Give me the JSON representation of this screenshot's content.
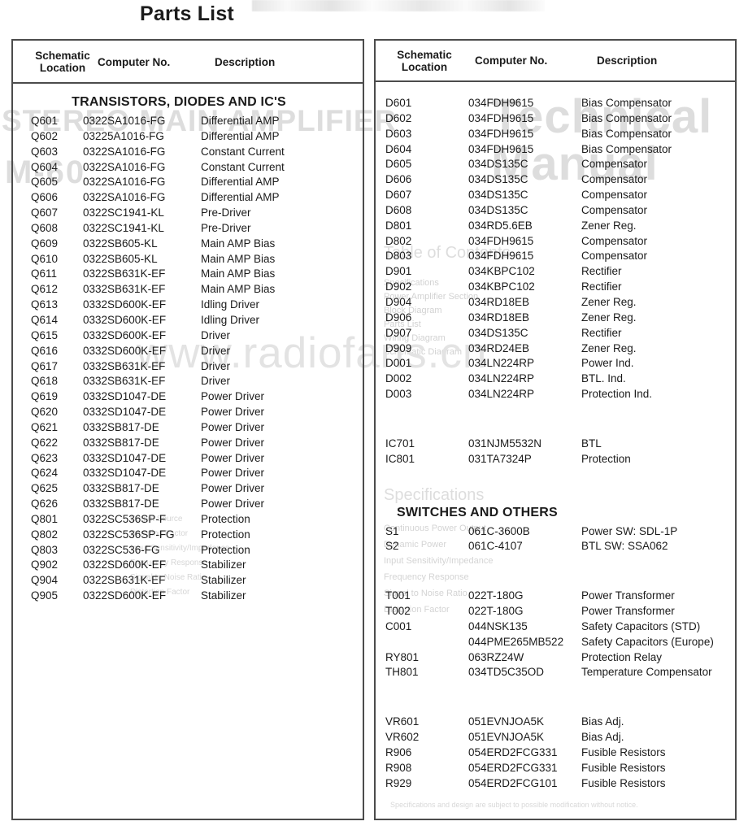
{
  "page": {
    "title": "Parts List",
    "watermark": "www.radiofans.cn"
  },
  "ghost_text": {
    "stereo": "STEREO MAIN AMPLIFIER",
    "model": "M-60",
    "brand_line1": "Technical",
    "brand_line2": "Manual",
    "toc": "Table of Contents",
    "spec": "Specifications",
    "toc_lines": "Specifications\nPower Amplifier Section\nBlock Diagram\nParts List\nWiring Diagram\nSchematic Diagram",
    "spec_lines": "Continuous Power Output\nDynamic Power\nInput Sensitivity/Impedance\nFrequency Response\nSignal to Noise Ratio\nDistortion Factor",
    "mid_lines": "Output Source\nDamping Factor\nInput Sensitivity/Impedance\nFrequency Response\nSignal to Noise Ratio\nDistortion Factor",
    "bottom_note": "Specifications and design are subject to possible modification without notice."
  },
  "tables": {
    "left": {
      "headers": {
        "location": "Schematic\nLocation",
        "location_line1": "Schematic",
        "location_line2": "Location",
        "number": "Computer No.",
        "description": "Description"
      },
      "sections": [
        {
          "title": "TRANSISTORS, DIODES AND IC'S",
          "rows": [
            {
              "loc": "Q601",
              "num": "0322SA1016-FG",
              "desc": "Differential AMP"
            },
            {
              "loc": "Q602",
              "num": "03225A1016-FG",
              "desc": "Differential AMP"
            },
            {
              "loc": "Q603",
              "num": "0322SA1016-FG",
              "desc": "Constant Current"
            },
            {
              "loc": "Q604",
              "num": "0322SA1016-FG",
              "desc": "Constant Current"
            },
            {
              "loc": "Q605",
              "num": "0322SA1016-FG",
              "desc": "Differential AMP"
            },
            {
              "loc": "Q606",
              "num": "0322SA1016-FG",
              "desc": "Differential AMP"
            },
            {
              "loc": "Q607",
              "num": "0322SC1941-KL",
              "desc": "Pre-Driver"
            },
            {
              "loc": "Q608",
              "num": "0322SC1941-KL",
              "desc": "Pre-Driver"
            },
            {
              "loc": "Q609",
              "num": "0322SB605-KL",
              "desc": "Main AMP Bias"
            },
            {
              "loc": "Q610",
              "num": "0322SB605-KL",
              "desc": "Main AMP Bias"
            },
            {
              "loc": "Q611",
              "num": "0322SB631K-EF",
              "desc": "Main AMP Bias"
            },
            {
              "loc": "Q612",
              "num": "0332SB631K-EF",
              "desc": "Main AMP Bias"
            },
            {
              "loc": "Q613",
              "num": "0332SD600K-EF",
              "desc": "Idling Driver"
            },
            {
              "loc": "Q614",
              "num": "0332SD600K-EF",
              "desc": "Idling Driver"
            },
            {
              "loc": "Q615",
              "num": "0332SD600K-EF",
              "desc": "Driver"
            },
            {
              "loc": "Q616",
              "num": "0332SD600K-EF",
              "desc": "Driver"
            },
            {
              "loc": "Q617",
              "num": "0332SB631K-EF",
              "desc": "Driver"
            },
            {
              "loc": "Q618",
              "num": "0332SB631K-EF",
              "desc": "Driver"
            },
            {
              "loc": "Q619",
              "num": "0332SD1047-DE",
              "desc": "Power Driver"
            },
            {
              "loc": "Q620",
              "num": "0332SD1047-DE",
              "desc": "Power Driver"
            },
            {
              "loc": "Q621",
              "num": "0332SB817-DE",
              "desc": "Power Driver"
            },
            {
              "loc": "Q622",
              "num": "0332SB817-DE",
              "desc": "Power Driver"
            },
            {
              "loc": "Q623",
              "num": "0332SD1047-DE",
              "desc": "Power Driver"
            },
            {
              "loc": "Q624",
              "num": "0332SD1047-DE",
              "desc": "Power Driver"
            },
            {
              "loc": "Q625",
              "num": "0332SB817-DE",
              "desc": "Power Driver"
            },
            {
              "loc": "Q626",
              "num": "0332SB817-DE",
              "desc": "Power Driver"
            },
            {
              "loc": "Q801",
              "num": "0322SC536SP-F",
              "desc": "Protection"
            },
            {
              "loc": "Q802",
              "num": "0322SC536SP-FG",
              "desc": "Protection"
            },
            {
              "loc": "Q803",
              "num": "0322SC536-FG",
              "desc": "Protection"
            },
            {
              "loc": "Q902",
              "num": "0322SD600K-EF",
              "desc": "Stabilizer"
            },
            {
              "loc": "Q904",
              "num": "0322SB631K-EF",
              "desc": "Stabilizer"
            },
            {
              "loc": "Q905",
              "num": "0322SD600K-EF",
              "desc": "Stabilizer"
            }
          ]
        }
      ]
    },
    "right": {
      "headers": {
        "location_line1": "Schematic",
        "location_line2": "Location",
        "number": "Computer No.",
        "description": "Description"
      },
      "groups": [
        {
          "title": "",
          "rows": [
            {
              "loc": "D601",
              "num": "034FDH9615",
              "desc": "Bias Compensator"
            },
            {
              "loc": "D602",
              "num": "034FDH9615",
              "desc": "Bias Compensator"
            },
            {
              "loc": "D603",
              "num": "034FDH9615",
              "desc": "Bias Compensator"
            },
            {
              "loc": "D604",
              "num": "034FDH9615",
              "desc": "Bias Compensator"
            },
            {
              "loc": "D605",
              "num": "034DS135C",
              "desc": "Compensator"
            },
            {
              "loc": "D606",
              "num": "034DS135C",
              "desc": "Compensator"
            },
            {
              "loc": "D607",
              "num": "034DS135C",
              "desc": "Compensator"
            },
            {
              "loc": "D608",
              "num": "034DS135C",
              "desc": "Compensator"
            },
            {
              "loc": "D801",
              "num": "034RD5.6EB",
              "desc": "Zener Reg."
            },
            {
              "loc": "D802",
              "num": "034FDH9615",
              "desc": "Compensator"
            },
            {
              "loc": "D803",
              "num": "034FDH9615",
              "desc": "Compensator"
            },
            {
              "loc": "D901",
              "num": "034KBPC102",
              "desc": "Rectifier"
            },
            {
              "loc": "D902",
              "num": "034KBPC102",
              "desc": "Rectifier"
            },
            {
              "loc": "D904",
              "num": "034RD18EB",
              "desc": "Zener Reg."
            },
            {
              "loc": "D906",
              "num": "034RD18EB",
              "desc": "Zener Reg."
            },
            {
              "loc": "D907",
              "num": "034DS135C",
              "desc": "Rectifier"
            },
            {
              "loc": "D909",
              "num": "034RD24EB",
              "desc": "Zener Reg."
            },
            {
              "loc": "D001",
              "num": "034LN224RP",
              "desc": "Power Ind."
            },
            {
              "loc": "D002",
              "num": "034LN224RP",
              "desc": "BTL. Ind."
            },
            {
              "loc": "D003",
              "num": "034LN224RP",
              "desc": "Protection Ind."
            }
          ]
        },
        {
          "title": "",
          "rows": [
            {
              "loc": "IC701",
              "num": "031NJM5532N",
              "desc": "BTL"
            },
            {
              "loc": "IC801",
              "num": "031TA7324P",
              "desc": "Protection"
            }
          ]
        },
        {
          "title": "SWITCHES AND OTHERS",
          "rows": [
            {
              "loc": "S1",
              "num": "061C-3600B",
              "desc": "Power SW: SDL-1P"
            },
            {
              "loc": "S2",
              "num": "061C-4107",
              "desc": "BTL SW: SSA062"
            }
          ]
        },
        {
          "title": "",
          "rows": [
            {
              "loc": "T001",
              "num": "022T-180G",
              "desc": "Power Transformer"
            },
            {
              "loc": "T002",
              "num": "022T-180G",
              "desc": "Power Transformer"
            },
            {
              "loc": "C001",
              "num": "044NSK135",
              "desc": "Safety Capacitors (STD)"
            },
            {
              "loc": "",
              "num": "044PME265MB522",
              "desc": "Safety Capacitors (Europe)"
            },
            {
              "loc": "RY801",
              "num": "063RZ24W",
              "desc": "Protection Relay"
            },
            {
              "loc": "TH801",
              "num": "034TD5C35OD",
              "desc": "Temperature Compensator"
            }
          ]
        },
        {
          "title": "",
          "rows": [
            {
              "loc": "VR601",
              "num": "051EVNJOA5K",
              "desc": "Bias Adj."
            },
            {
              "loc": "VR602",
              "num": "051EVNJOA5K",
              "desc": "Bias Adj."
            },
            {
              "loc": "R906",
              "num": "054ERD2FCG331",
              "desc": "Fusible Resistors"
            },
            {
              "loc": "R908",
              "num": "054ERD2FCG331",
              "desc": "Fusible Resistors"
            },
            {
              "loc": "R929",
              "num": "054ERD2FCG101",
              "desc": "Fusible Resistors"
            }
          ]
        }
      ]
    }
  }
}
